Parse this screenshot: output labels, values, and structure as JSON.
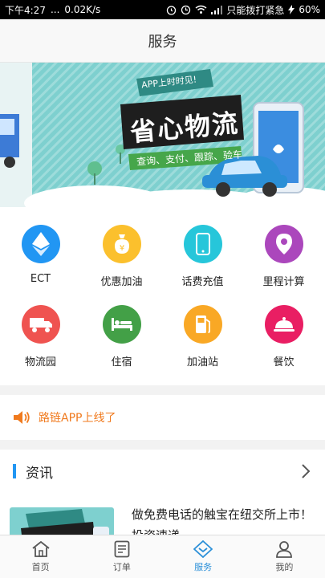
{
  "status_bar": {
    "time": "下午4:27",
    "dots": "...",
    "speed": "0.02K/s",
    "carrier": "只能拨打紧急",
    "battery": "60%"
  },
  "header": {
    "title": "服务"
  },
  "banner": {
    "tag": "APP上时时见!",
    "headline": "省心物流",
    "subline": "查询、支付、跟踪、验车"
  },
  "services": [
    {
      "label": "ECT",
      "icon": "ethereum-icon",
      "color": "#2196f3"
    },
    {
      "label": "优惠加油",
      "icon": "money-bag-icon",
      "color": "#fbc02d"
    },
    {
      "label": "话费充值",
      "icon": "phone-icon",
      "color": "#26c6da"
    },
    {
      "label": "里程计算",
      "icon": "location-pin-icon",
      "color": "#ab47bc"
    },
    {
      "label": "物流园",
      "icon": "truck-icon",
      "color": "#ef5350"
    },
    {
      "label": "住宿",
      "icon": "bed-icon",
      "color": "#43a047"
    },
    {
      "label": "加油站",
      "icon": "fuel-pump-icon",
      "color": "#f9a825"
    },
    {
      "label": "餐饮",
      "icon": "dining-cloche-icon",
      "color": "#e91e63"
    }
  ],
  "notice": {
    "text": "路链APP上线了",
    "color": "#f07a1e"
  },
  "news": {
    "section_title": "资讯",
    "items": [
      {
        "title": "做免费电话的触宝在纽交所上市！投资速递"
      }
    ]
  },
  "tabs": [
    {
      "label": "首页",
      "icon": "home-icon",
      "active": false
    },
    {
      "label": "订单",
      "icon": "order-icon",
      "active": false
    },
    {
      "label": "服务",
      "icon": "service-icon",
      "active": true
    },
    {
      "label": "我的",
      "icon": "user-icon",
      "active": false
    }
  ],
  "colors": {
    "accent": "#2a8fd8",
    "news_bar": "#2196f3"
  }
}
